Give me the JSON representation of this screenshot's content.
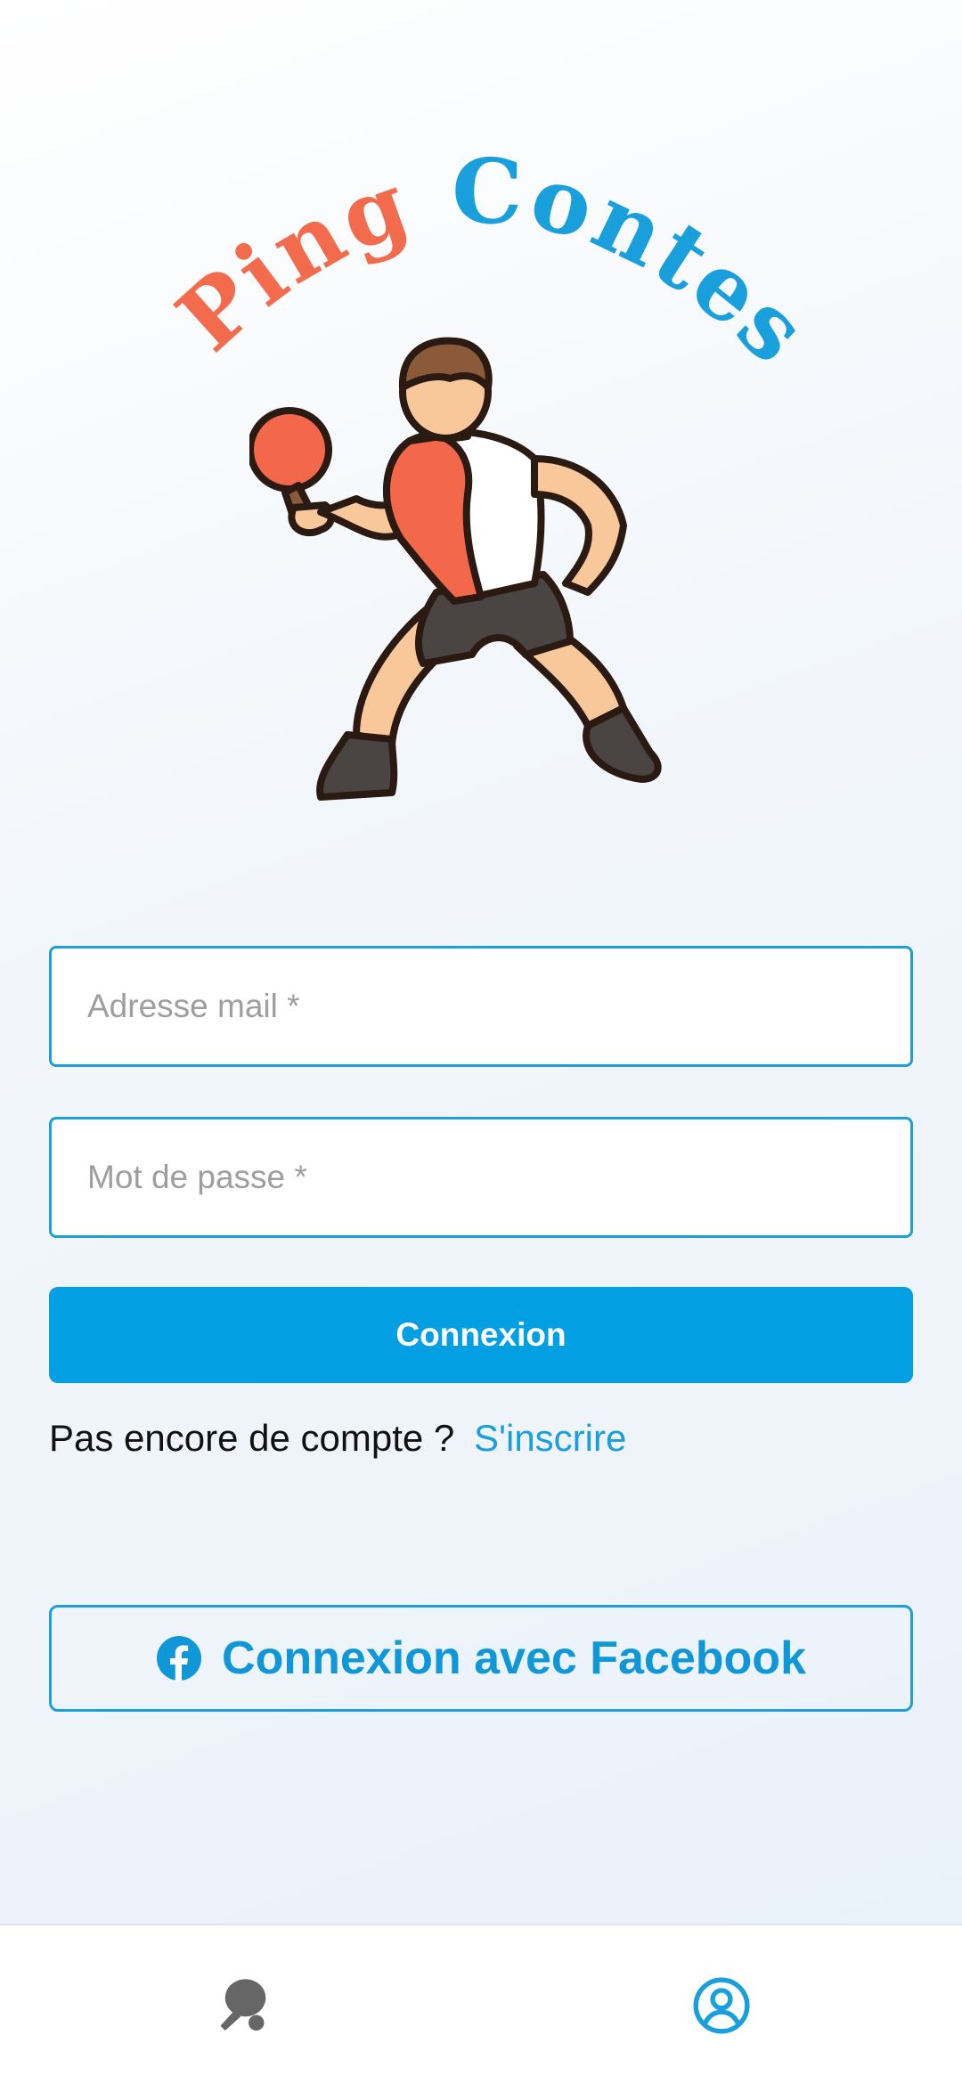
{
  "app": {
    "logo_word1": "Ping",
    "logo_word2": "Contest"
  },
  "form": {
    "email_placeholder": "Adresse mail *",
    "email_value": "",
    "password_placeholder": "Mot de passe *",
    "password_value": "",
    "submit_label": "Connexion"
  },
  "signup": {
    "prompt": "Pas encore de compte ?",
    "link_label": "S'inscrire"
  },
  "social": {
    "facebook_label": "Connexion avec Facebook",
    "facebook_icon": "facebook-icon"
  },
  "bottom_nav": {
    "items": [
      {
        "icon": "table-tennis-icon",
        "active": false
      },
      {
        "icon": "account-icon",
        "active": true
      }
    ]
  },
  "colors": {
    "accent": "#039fe3",
    "logo_orange": "#f36b4d",
    "logo_blue": "#1a9fdd",
    "inactive_icon": "#666666"
  }
}
